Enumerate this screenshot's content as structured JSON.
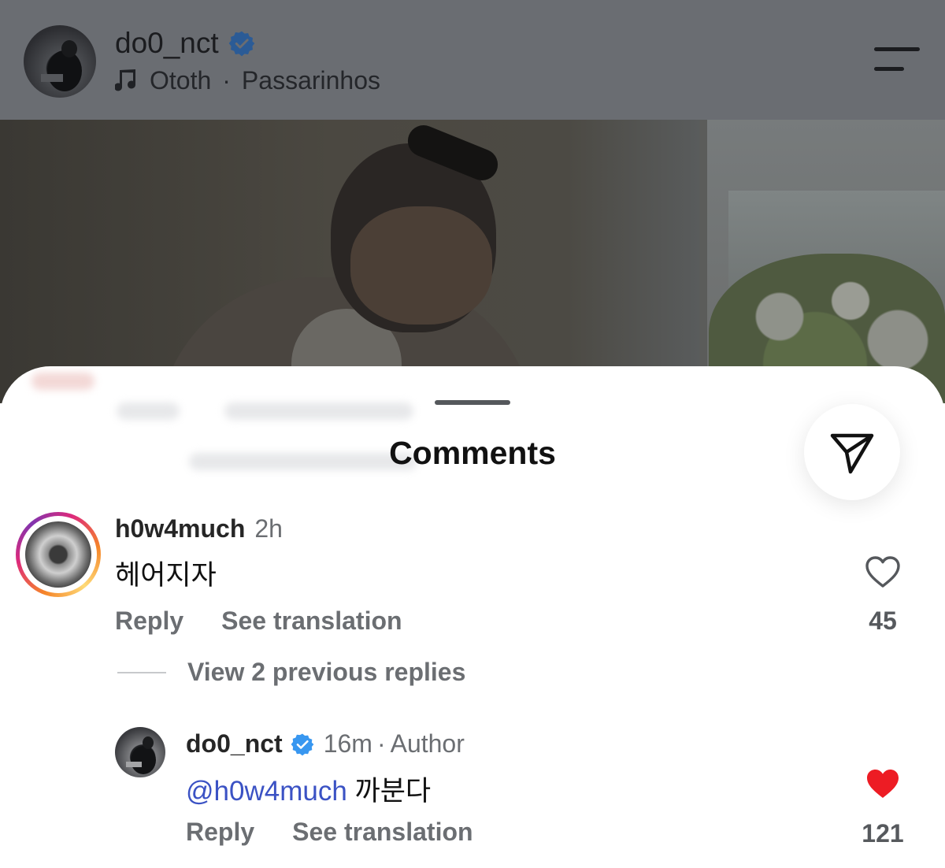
{
  "post_header": {
    "username": "do0_nct",
    "music_artist": "Ototh",
    "music_separator": "·",
    "music_track": "Passarinhos"
  },
  "sheet": {
    "title": "Comments"
  },
  "comments": [
    {
      "username": "h0w4much",
      "time": "2h",
      "text": "헤어지자",
      "reply_label": "Reply",
      "translate_label": "See translation",
      "like_count": "45",
      "liked": false
    }
  ],
  "view_replies_label": "View 2 previous replies",
  "reply": {
    "username": "do0_nct",
    "time": "16m",
    "separator": "·",
    "author_label": "Author",
    "mention": "@h0w4much",
    "text": "까분다",
    "reply_label": "Reply",
    "translate_label": "See translation",
    "like_count": "121",
    "liked": true
  },
  "colors": {
    "dim_overlay": "#6a6d72",
    "verified": "#3897f0",
    "liked_heart": "#ed1c24",
    "mention": "#3b52c4"
  },
  "icons": [
    "verified-badge-icon",
    "music-note-icon",
    "menu-icon",
    "share-send-icon",
    "heart-outline-icon",
    "heart-filled-icon"
  ]
}
